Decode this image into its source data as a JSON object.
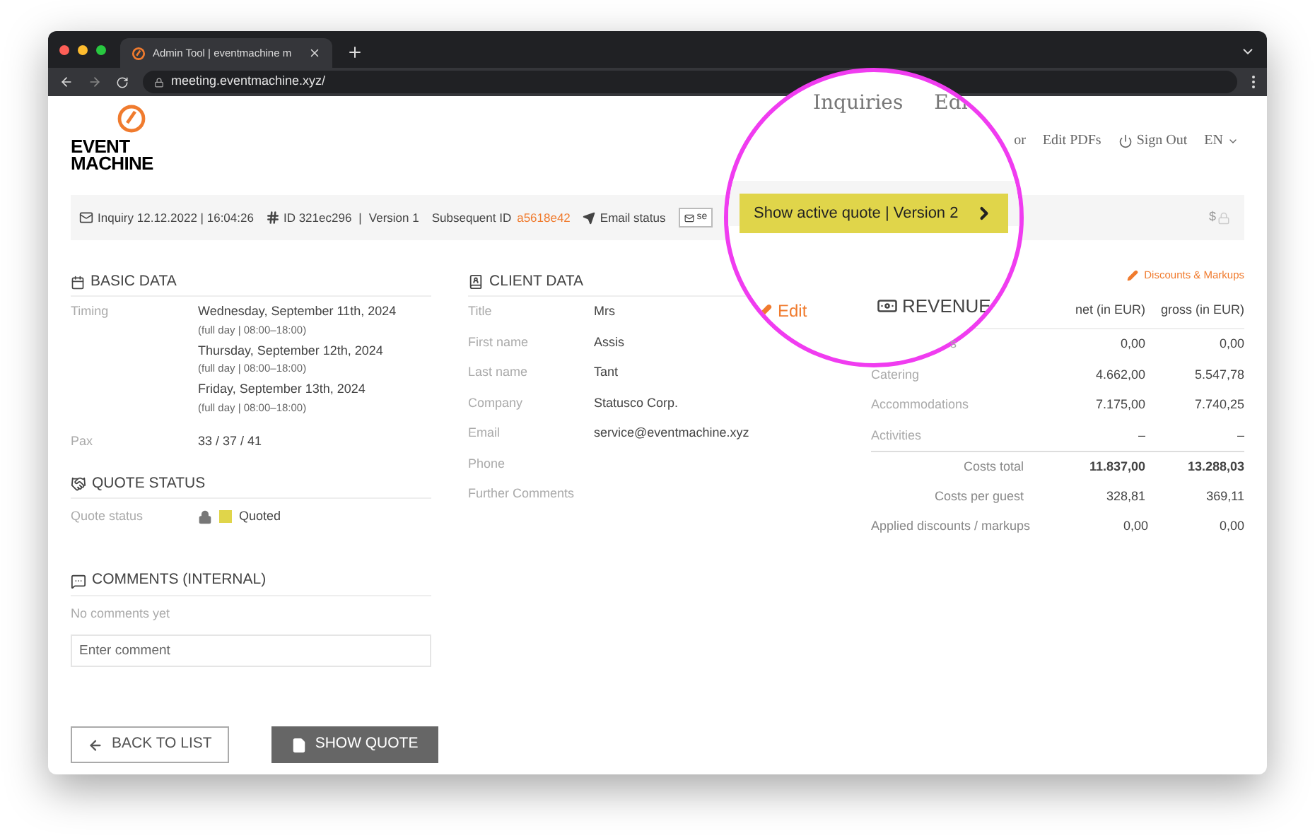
{
  "browser": {
    "tab_title": "Admin Tool | eventmachine m",
    "url": "meeting.eventmachine.xyz/"
  },
  "header": {
    "logo_lines": [
      "EVENT",
      "MACHINE"
    ],
    "nav": [
      "or",
      "Edit PDFs"
    ],
    "sign_out": "Sign Out",
    "language": "EN"
  },
  "info_bar": {
    "inquiry_label": "Inquiry",
    "inquiry_date": "12.12.2022 | 16:04:26",
    "id_label": "ID",
    "id": "321ec296",
    "separator": "|",
    "version_label": "Version",
    "version": "1",
    "subsequent_label": "Subsequent ID",
    "subsequent_id": "a5618e42",
    "email_label": "Email status",
    "email_button": "se",
    "currency": "$"
  },
  "basic_data": {
    "title": "BASIC DATA",
    "timing_label": "Timing",
    "dates": [
      {
        "date": "Wednesday, September 11th, 2024",
        "hours": "(full day | 08:00–18:00)"
      },
      {
        "date": "Thursday, September 12th, 2024",
        "hours": "(full day | 08:00–18:00)"
      },
      {
        "date": "Friday, September 13th, 2024",
        "hours": "(full day | 08:00–18:00)"
      }
    ],
    "pax_label": "Pax",
    "pax": "33 / 37 / 41"
  },
  "quote_status": {
    "title": "QUOTE STATUS",
    "label": "Quote status",
    "locked": true,
    "color": "#e0d54a",
    "value": "Quoted"
  },
  "comments": {
    "title": "COMMENTS (INTERNAL)",
    "empty_text": "No comments yet",
    "placeholder": "Enter comment"
  },
  "client_data": {
    "title": "CLIENT DATA",
    "edit_link": "Edit",
    "rows": [
      {
        "label": "Title",
        "value": "Mrs"
      },
      {
        "label": "First name",
        "value": "Assis"
      },
      {
        "label": "Last name",
        "value": "Tant"
      },
      {
        "label": "Company",
        "value": "Statusco Corp."
      },
      {
        "label": "Email",
        "value": "service@eventmachine.xyz"
      },
      {
        "label": "Phone"
      },
      {
        "label": "Further Comments"
      }
    ]
  },
  "revenue": {
    "discounts_link": "Discounts & Markups",
    "title": "REVENUE",
    "columns": [
      "net (in EUR)",
      "gross (in EUR)"
    ],
    "rows": [
      {
        "kind": "item",
        "label": "s",
        "net": "0,00",
        "gross": "0,00"
      },
      {
        "kind": "item",
        "label": "Catering",
        "net": "4.662,00",
        "gross": "5.547,78"
      },
      {
        "kind": "item",
        "label": "Accommodations",
        "net": "7.175,00",
        "gross": "7.740,25"
      },
      {
        "kind": "item",
        "label": "Activities",
        "net": "–",
        "gross": "–"
      },
      {
        "kind": "total",
        "label": "Costs total",
        "net": "11.837,00",
        "gross": "13.288,03"
      },
      {
        "kind": "summary",
        "label": "Costs per guest",
        "net": "328,81",
        "gross": "369,11"
      },
      {
        "kind": "summary",
        "label": "Applied discounts / markups",
        "net": "0,00",
        "gross": "0,00"
      }
    ]
  },
  "magnifier": {
    "nav": [
      "Inquiries",
      "Edi"
    ],
    "quote_button": "Show active quote | Version 2"
  },
  "buttons": [
    {
      "kind": "outline",
      "label": "BACK TO LIST"
    },
    {
      "kind": "filled",
      "label": "SHOW QUOTE"
    }
  ]
}
